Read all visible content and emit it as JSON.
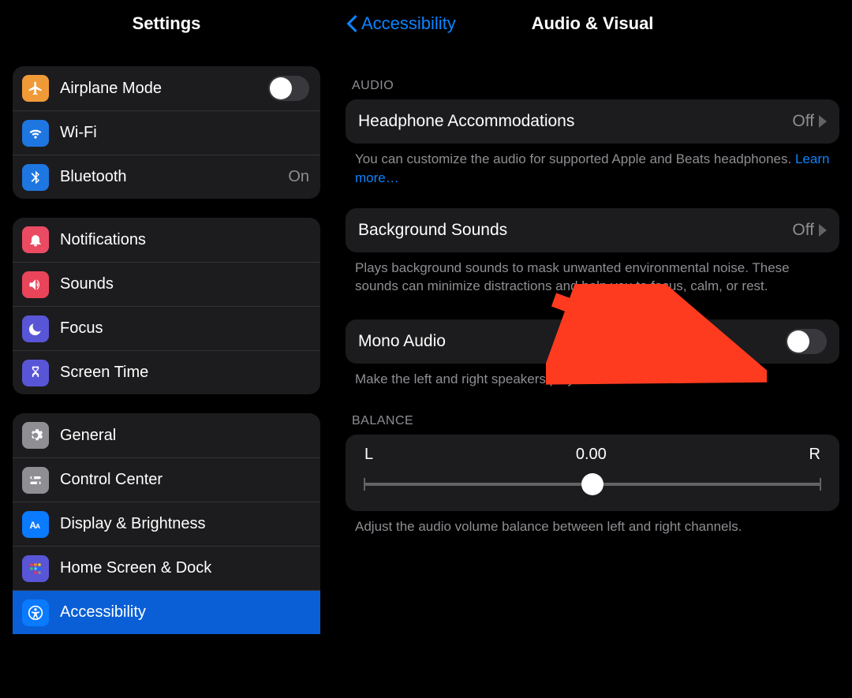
{
  "left": {
    "title": "Settings",
    "group1": {
      "airplane": {
        "label": "Airplane Mode",
        "on": false
      },
      "wifi": {
        "label": "Wi-Fi"
      },
      "bluetooth": {
        "label": "Bluetooth",
        "value": "On"
      }
    },
    "group2": {
      "notifications": {
        "label": "Notifications"
      },
      "sounds": {
        "label": "Sounds"
      },
      "focus": {
        "label": "Focus"
      },
      "screentime": {
        "label": "Screen Time"
      }
    },
    "group3": {
      "general": {
        "label": "General"
      },
      "controlcenter": {
        "label": "Control Center"
      },
      "display": {
        "label": "Display & Brightness"
      },
      "homescreen": {
        "label": "Home Screen & Dock"
      },
      "accessibility": {
        "label": "Accessibility"
      }
    }
  },
  "right": {
    "back_label": "Accessibility",
    "title": "Audio & Visual",
    "audio_header": "AUDIO",
    "headphone": {
      "label": "Headphone Accommodations",
      "value": "Off"
    },
    "headphone_caption_a": "You can customize the audio for supported Apple and Beats headphones. ",
    "headphone_caption_link": "Learn more…",
    "background": {
      "label": "Background Sounds",
      "value": "Off"
    },
    "background_caption": "Plays background sounds to mask unwanted environmental noise. These sounds can minimize distractions and help you to focus, calm, or rest.",
    "mono": {
      "label": "Mono Audio",
      "on": false
    },
    "mono_caption": "Make the left and right speakers play the same content.",
    "balance_header": "BALANCE",
    "balance": {
      "L": "L",
      "R": "R",
      "value": "0.00"
    },
    "balance_caption": "Adjust the audio volume balance between left and right channels."
  }
}
